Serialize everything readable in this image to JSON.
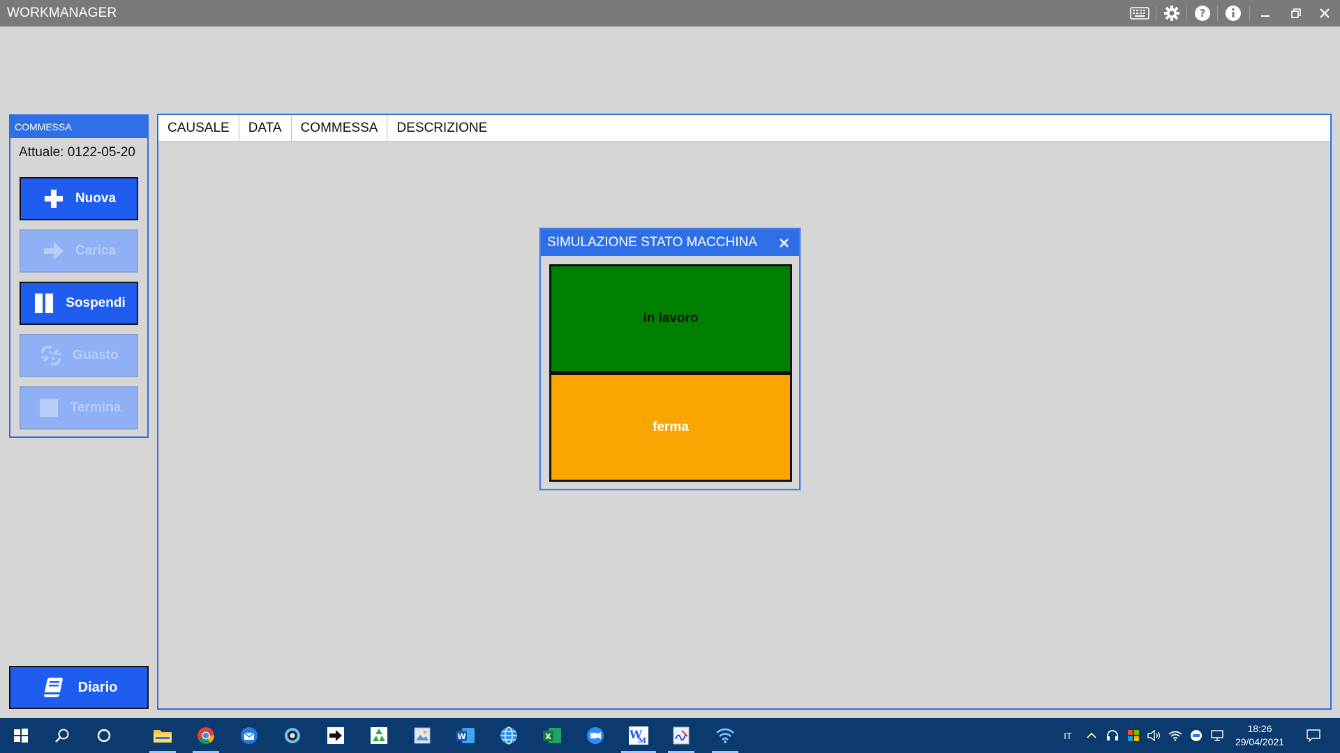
{
  "app": {
    "title": "WORKMANAGER"
  },
  "title_icons": [
    "keyboard-icon",
    "gear-icon",
    "help-icon",
    "info-icon",
    "minimize-icon",
    "restore-icon",
    "close-icon"
  ],
  "commessa": {
    "header": "COMMESSA",
    "current": "Attuale: 0122-05-20",
    "buttons": [
      {
        "label": "Nuova",
        "icon": "plus-icon",
        "enabled": true
      },
      {
        "label": "Carica",
        "icon": "arrow-right-icon",
        "enabled": false
      },
      {
        "label": "Sospendi",
        "icon": "pause-icon",
        "enabled": true
      },
      {
        "label": "Guasto",
        "icon": "broken-link-icon",
        "enabled": false
      },
      {
        "label": "Termina",
        "icon": "stop-icon",
        "enabled": false
      }
    ]
  },
  "grid": {
    "columns": [
      "CAUSALE",
      "DATA",
      "COMMESSA",
      "DESCRIZIONE"
    ]
  },
  "dialog": {
    "title": "SIMULAZIONE STATO MACCHINA",
    "states": [
      {
        "label": "in lavoro",
        "color": "#008000"
      },
      {
        "label": "ferma",
        "color": "#FBA500"
      }
    ]
  },
  "diario": {
    "label": "Diario",
    "icon": "book-icon"
  },
  "colors": {
    "accent": "#2F6FE6",
    "button": "#1F5CF0",
    "titlebar": "#7A7A7A",
    "taskbar": "#0A3A6E"
  },
  "taskbar": {
    "apps": [
      "start-icon",
      "search-icon",
      "cortana-icon",
      "file-explorer-icon",
      "chrome-icon",
      "thunderbird-icon",
      "webcam-icon",
      "arrow-app-icon",
      "recycle-app-icon",
      "image-viewer-icon",
      "word-icon",
      "globe-app-icon",
      "excel-icon",
      "zoom-icon",
      "workmanager-icon",
      "signature-app-icon",
      "wifi-app-icon"
    ],
    "language": "IT",
    "time": "18:26",
    "date": "29/04/2021"
  }
}
